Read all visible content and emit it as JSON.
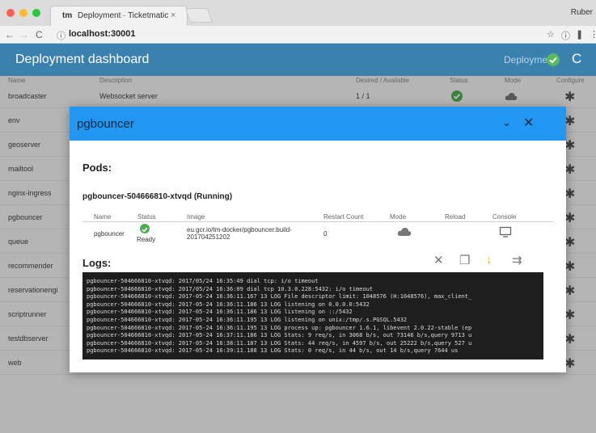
{
  "browser": {
    "tab_favicon": "tm",
    "tab_title": "Deployment · Ticketmatic",
    "tab_close": "×",
    "profile": "Ruber",
    "back": "←",
    "forward": "→",
    "reload": "C",
    "info": "ⓘ",
    "url": "localhost:30001",
    "star": "☆",
    "ext1": "ⓘ",
    "ext2": "❚",
    "menu": "⋮"
  },
  "app": {
    "title": "Deployment dashboard",
    "deployment_label": "Deployment:",
    "refresh": "C"
  },
  "table": {
    "headers": {
      "name": "Name",
      "description": "Description",
      "desired": "Desired / Available",
      "status": "Status",
      "mode": "Mode",
      "configure": "Configure"
    },
    "rows": [
      {
        "name": "broadcaster",
        "description": "Websocket server",
        "desired": "1 / 1"
      },
      {
        "name": "env",
        "description": "",
        "desired": ""
      },
      {
        "name": "geoserver",
        "description": "",
        "desired": ""
      },
      {
        "name": "mailtool",
        "description": "",
        "desired": ""
      },
      {
        "name": "nginx-ingress",
        "description": "",
        "desired": ""
      },
      {
        "name": "pgbouncer",
        "description": "",
        "desired": ""
      },
      {
        "name": "queue",
        "description": "",
        "desired": ""
      },
      {
        "name": "recommender",
        "description": "",
        "desired": ""
      },
      {
        "name": "reservationengi",
        "description": "",
        "desired": ""
      },
      {
        "name": "scriptrunner",
        "description": "",
        "desired": ""
      },
      {
        "name": "testdbserver",
        "description": "",
        "desired": ""
      },
      {
        "name": "web",
        "description": "",
        "desired": ""
      }
    ],
    "gear": "✱"
  },
  "modal": {
    "title": "pgbouncer",
    "chevron": "⌄",
    "close": "✕",
    "pods_heading": "Pods:",
    "pod_title": "pgbouncer-504666810-xtvqd (Running)",
    "pod_headers": {
      "name": "Name",
      "status": "Status",
      "image": "Image",
      "restart": "Restart Count",
      "mode": "Mode",
      "reload": "Reload",
      "console": "Console"
    },
    "pod_row": {
      "name": "pgbouncer",
      "status": "Ready",
      "image_line1": "eu.gcr.io/tm-docker/pgbouncer:build-",
      "image_line2": "201704251202",
      "restart": "0"
    },
    "logs_heading": "Logs:",
    "log_icons": {
      "clear": "✕",
      "copy": "❐",
      "scroll": "↓",
      "wrap": "⇉"
    },
    "log_lines": [
      "pgbouncer-504666810-xtvqd: 2017/05/24 16:35:49 dial tcp: i/o timeout",
      "pgbouncer-504666810-xtvqd: 2017/05/24 16:36:09 dial tcp 10.3.0.228:5432: i/o timeout",
      "pgbouncer-504666810-xtvqd: 2017-05-24 16:36:11.167 13 LOG File descriptor limit: 1048576 (H:1048576), max_client_",
      "pgbouncer-504666810-xtvqd: 2017-05-24 16:36:11.186 13 LOG listening on 0.0.0.0:5432",
      "pgbouncer-504666810-xtvqd: 2017-05-24 16:36:11.186 13 LOG listening on ::/5432",
      "pgbouncer-504666810-xtvqd: 2017-05-24 16:36:11.195 13 LOG listening on unix:/tmp/.s.PGSQL.5432",
      "pgbouncer-504666810-xtvqd: 2017-05-24 16:36:11.195 13 LOG process up: pgbouncer 1.6.1, libevent 2.0.22-stable (ep",
      "pgbouncer-504666810-xtvqd: 2017-05-24 16:37:11.186 13 LOG Stats: 9 req/s, in 3068 b/s, out 73146 b/s,query 9713 u",
      "pgbouncer-504666810-xtvqd: 2017-05-24 16:38:11.187 13 LOG Stats: 44 req/s, in 4597 b/s, out 25222 b/s,query 527 u",
      "pgbouncer-504666810-xtvqd: 2017-05-24 16:39:11.188 13 LOG Stats: 0 req/s, in 44 b/s, out 14 b/s,query 7644 us"
    ]
  },
  "colors": {
    "appbar": "#3a82ad",
    "modal_header": "#2196f3",
    "ok": "#4caf50",
    "scroll_icon": "#f5a623"
  }
}
